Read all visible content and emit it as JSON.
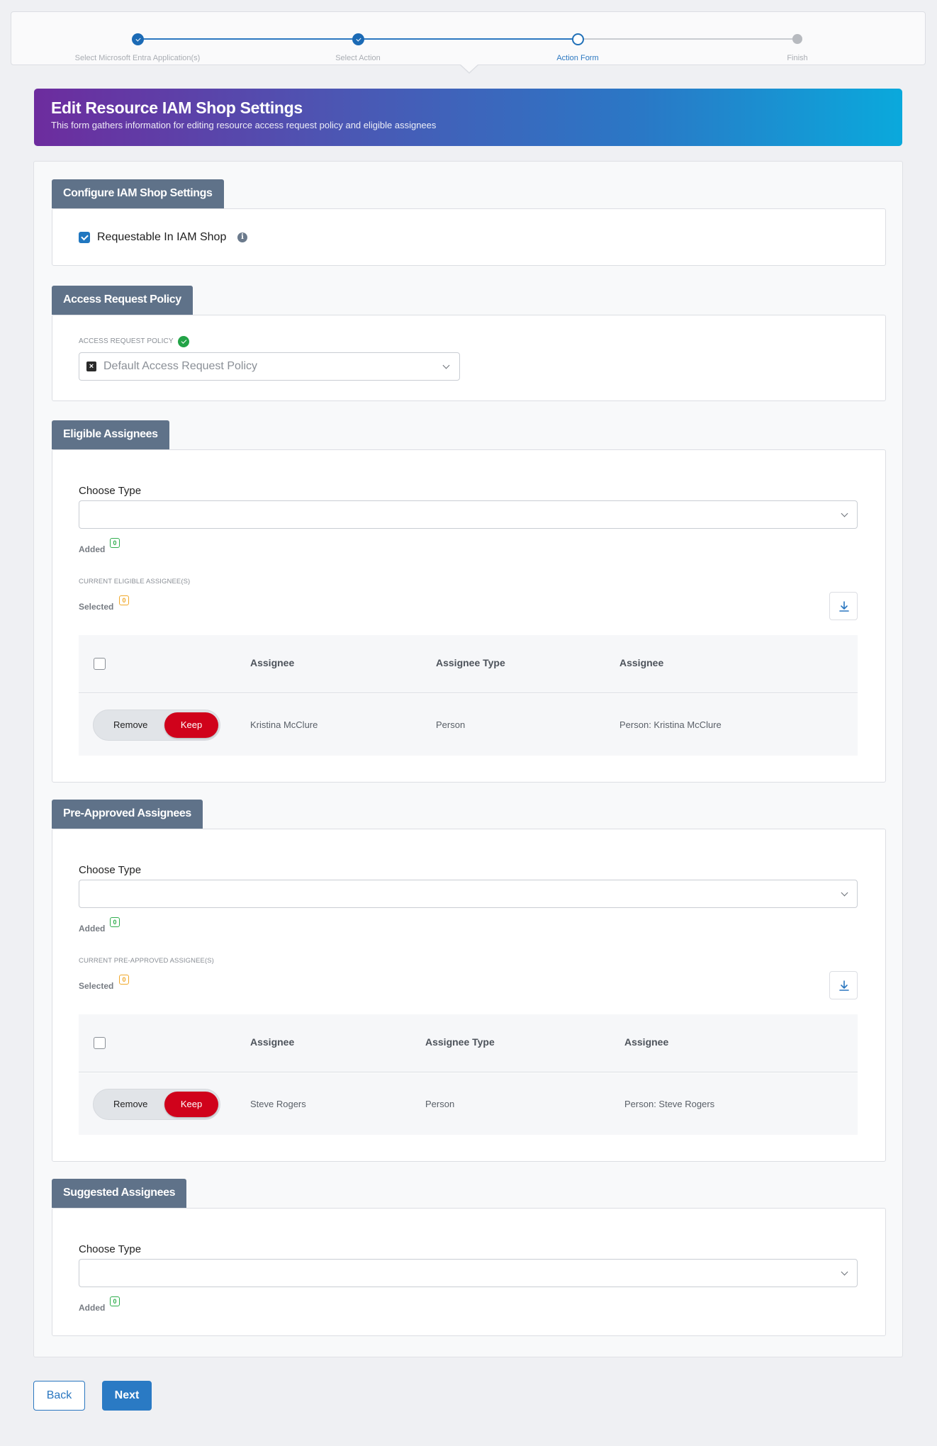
{
  "stepper": {
    "steps": [
      {
        "label": "Select Microsoft Entra Application(s)",
        "state": "done"
      },
      {
        "label": "Select Action",
        "state": "done"
      },
      {
        "label": "Action Form",
        "state": "current"
      },
      {
        "label": "Finish",
        "state": "todo"
      }
    ]
  },
  "banner": {
    "title": "Edit Resource IAM Shop Settings",
    "subtitle": "This form gathers information for editing resource access request policy and eligible assignees"
  },
  "configure": {
    "tab": "Configure IAM Shop Settings",
    "requestable_label": "Requestable In IAM Shop",
    "requestable_checked": true
  },
  "policy": {
    "tab": "Access Request Policy",
    "field_label": "ACCESS REQUEST POLICY",
    "value": "Default Access Request Policy"
  },
  "eligible": {
    "tab": "Eligible Assignees",
    "choose_type": "Choose Type",
    "added_label": "Added",
    "added_count": "0",
    "current_label": "CURRENT ELIGIBLE ASSIGNEE(S)",
    "selected_label": "Selected",
    "selected_count": "0",
    "columns": [
      "Assignee",
      "Assignee Type",
      "Assignee"
    ],
    "rows": [
      {
        "remove": "Remove",
        "keep": "Keep",
        "assignee": "Kristina McClure",
        "type": "Person",
        "assignee_full": "Person: Kristina McClure"
      }
    ]
  },
  "preapproved": {
    "tab": "Pre-Approved Assignees",
    "choose_type": "Choose Type",
    "added_label": "Added",
    "added_count": "0",
    "current_label": "CURRENT PRE-APPROVED ASSIGNEE(S)",
    "selected_label": "Selected",
    "selected_count": "0",
    "columns": [
      "Assignee",
      "Assignee Type",
      "Assignee"
    ],
    "rows": [
      {
        "remove": "Remove",
        "keep": "Keep",
        "assignee": "Steve Rogers",
        "type": "Person",
        "assignee_full": "Person: Steve Rogers"
      }
    ]
  },
  "suggested": {
    "tab": "Suggested Assignees",
    "choose_type": "Choose Type",
    "added_label": "Added",
    "added_count": "0"
  },
  "footer": {
    "back": "Back",
    "next": "Next"
  },
  "colors": {
    "primary": "#2a7ac4",
    "keep_active": "#d0021b",
    "section_tab": "#5f7289",
    "badge_green": "#2fae4d",
    "badge_orange": "#f0a82a"
  }
}
